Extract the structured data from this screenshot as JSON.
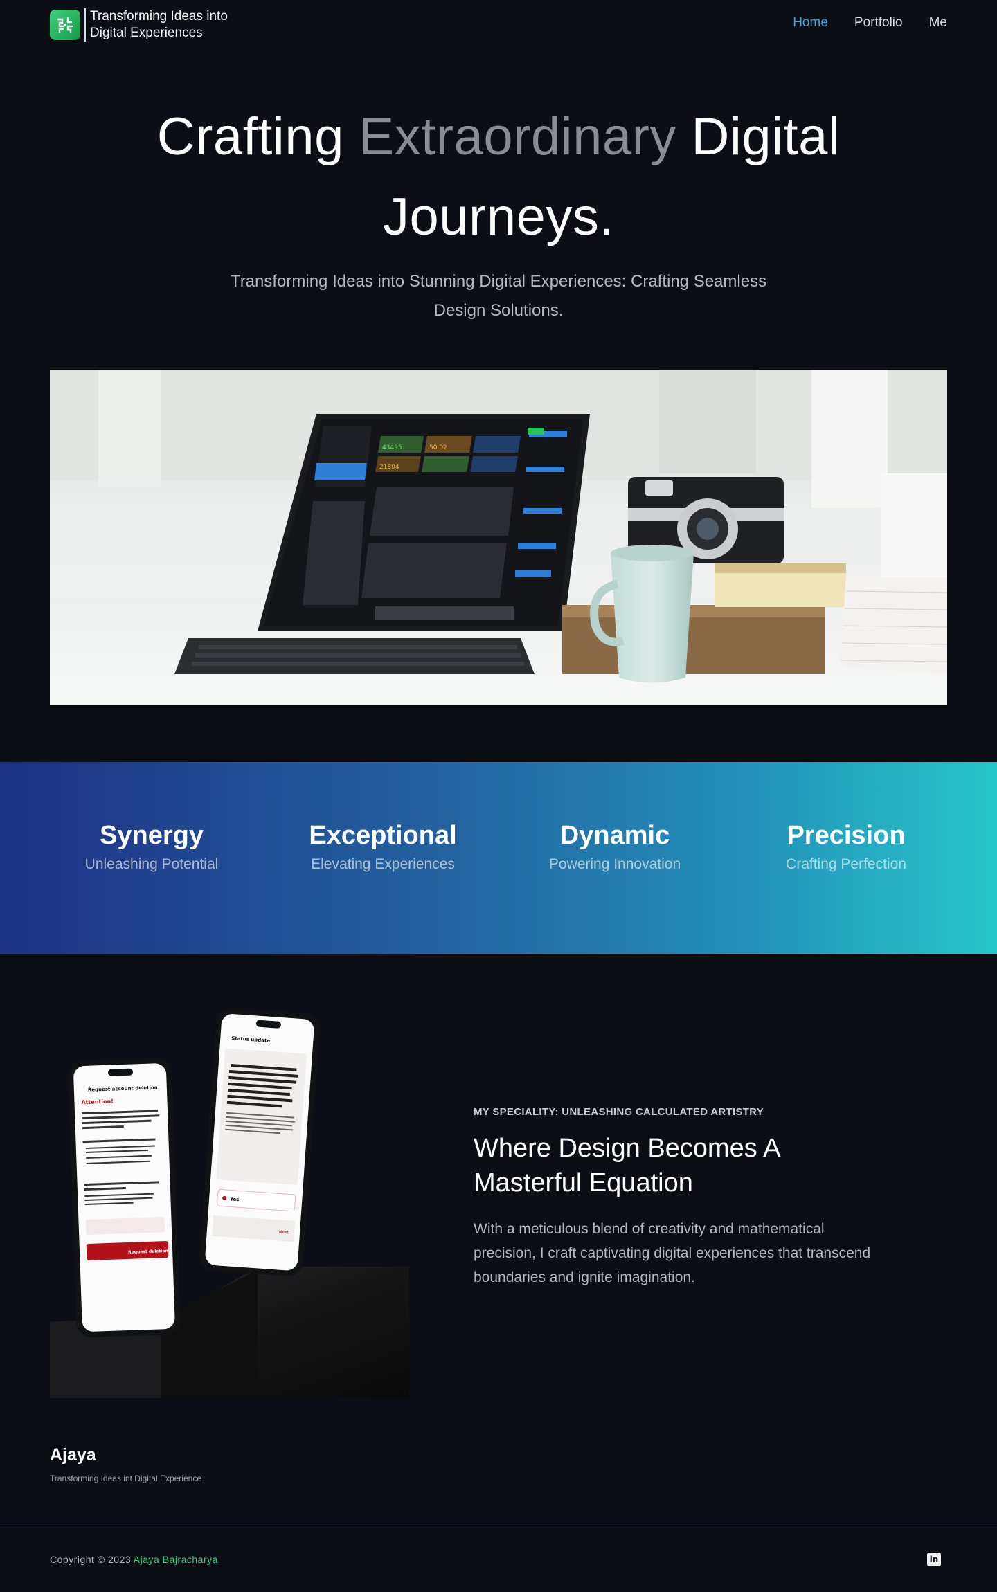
{
  "header": {
    "logo_line1": "Transforming Ideas into",
    "logo_line2": "Digital Experiences",
    "nav": [
      "Home",
      "Portfolio",
      "Me"
    ]
  },
  "hero": {
    "title_part1": "Crafting ",
    "title_highlight": "Extraordinary",
    "title_part2": " Digital Journeys.",
    "subtitle": "Transforming Ideas into Stunning Digital Experiences: Crafting Seamless Design Solutions."
  },
  "band": {
    "pillars": [
      {
        "title": "Synergy",
        "subtitle": "Unleashing Potential"
      },
      {
        "title": "Exceptional",
        "subtitle": "Elevating Experiences"
      },
      {
        "title": "Dynamic",
        "subtitle": "Powering Innovation"
      },
      {
        "title": "Precision",
        "subtitle": "Crafting Perfection"
      }
    ]
  },
  "speciality": {
    "eyebrow": "MY SPECIALITY: UNLEASHING CALCULATED ARTISTRY",
    "title": "Where Design Becomes A Masterful Equation",
    "body": "With a meticulous blend of creativity and mathematical precision, I craft captivating digital experiences that transcend boundaries and ignite imagination.",
    "phone_left": {
      "header": "Request account deletion",
      "attention": "Attention!",
      "button": "Request deletion"
    },
    "phone_right": {
      "header": "Status update",
      "option": "Yes",
      "next": "Next"
    }
  },
  "tablet": {
    "stat1": "43495",
    "stat2": "50.02",
    "stat3": "21804"
  },
  "footer": {
    "name": "Ajaya",
    "tagline": "Transforming Ideas int Digital Experience",
    "copyright": "Copyright © 2023 ",
    "author": "Ajaya Bajracharya",
    "social_icon": "linkedin-icon"
  },
  "colors": {
    "background": "#0c0e15",
    "accent_blue": "#3aa9e0",
    "accent_green": "#33d17a",
    "gradient_start": "#1e3286",
    "gradient_end": "#27c6c8"
  }
}
